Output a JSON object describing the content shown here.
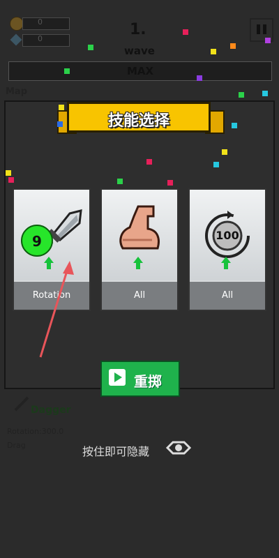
{
  "hud": {
    "coins": "0",
    "gems": "0",
    "wave_number": "1.",
    "wave_label": "wave",
    "max_label": "MAX",
    "map_label": "Map"
  },
  "dialog": {
    "title": "技能选择",
    "cards": [
      {
        "name": "Rotation",
        "icon": "dagger-icon",
        "level": "9"
      },
      {
        "name": "All",
        "icon": "muscle-arm-icon"
      },
      {
        "name": "All",
        "icon": "rotate-100-icon",
        "badge": "100"
      }
    ],
    "reroll_label": "重掷",
    "hold_hint": "按住即可隐藏"
  },
  "weapon_info": {
    "name": "Dagger",
    "line1": "Rotation:300.0",
    "line2": "Drag"
  },
  "colors": {
    "banner": "#f8c400",
    "reroll": "#1fb24c",
    "level_badge": "#27e52a",
    "upgrade_arrow": "#17c23b",
    "pointer_arrow": "#e8555a"
  }
}
